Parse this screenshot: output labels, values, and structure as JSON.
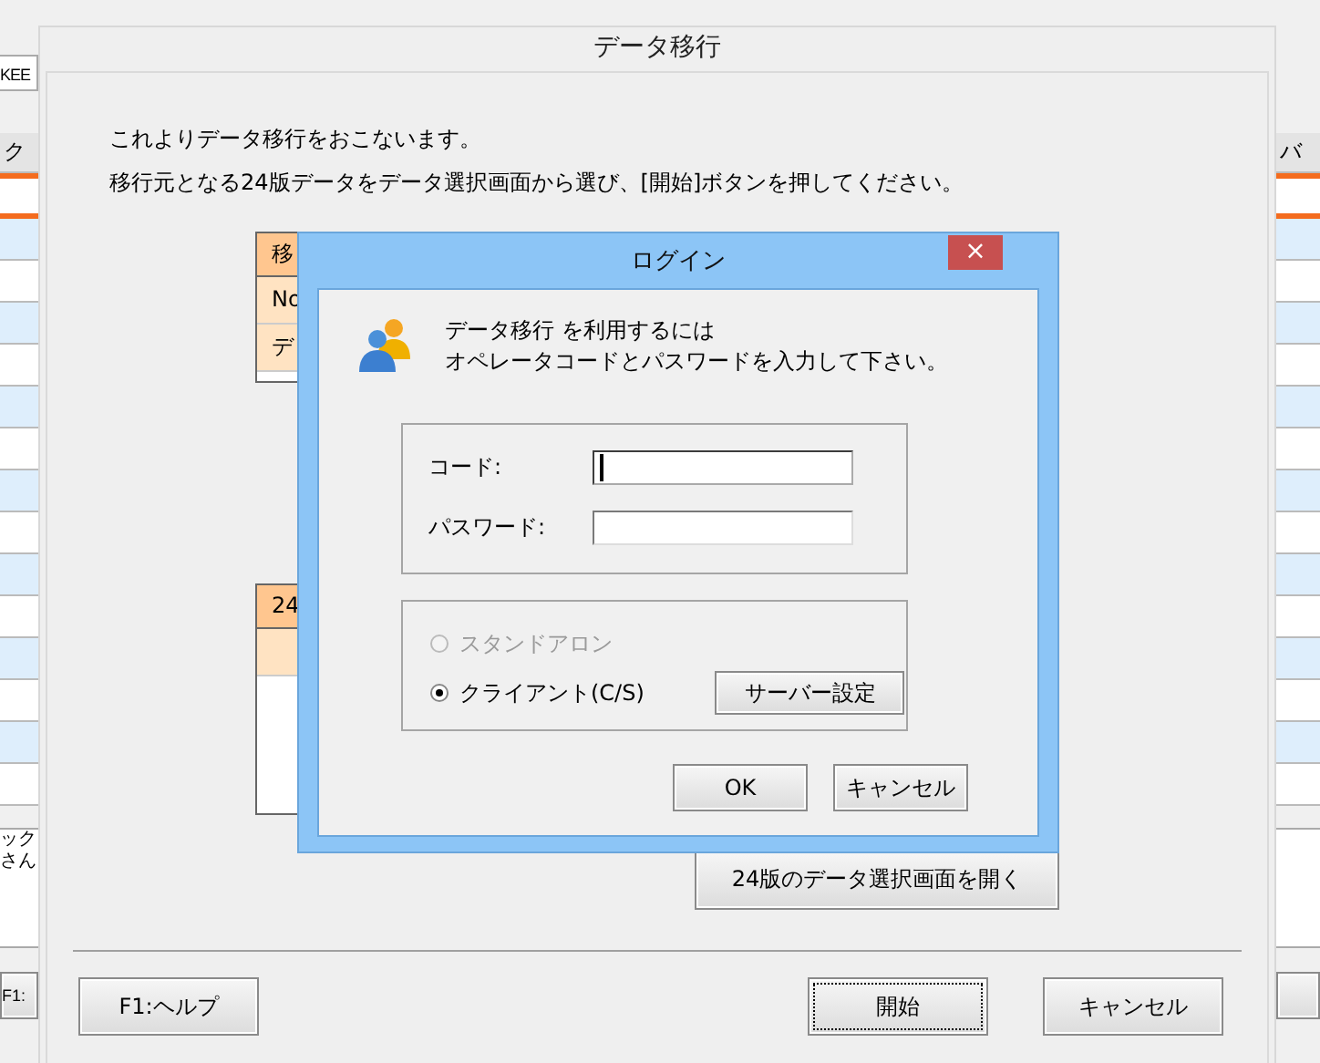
{
  "background_window": {
    "field_text": "KEE",
    "left_header": "ク",
    "right_header": "バ",
    "note_lines": [
      "ック",
      "さん"
    ],
    "button": "F1:"
  },
  "main_dialog": {
    "title": "データ移行",
    "intro": [
      "これよりデータ移行をおこないます。",
      "移行元となる24版データをデータ選択画面から選び、[開始]ボタンを押してください。"
    ],
    "source_table": {
      "header": "移",
      "rows": [
        "No",
        "デ"
      ]
    },
    "version_table": {
      "header": "24"
    },
    "open_button": "24版のデータ選択画面を開く",
    "buttons": [
      {
        "label": "F1:ヘルプ",
        "focused": false
      },
      {
        "label": "開始",
        "focused": true
      },
      {
        "label": "キャンセル",
        "focused": false
      }
    ]
  },
  "login_dialog": {
    "title": "ログイン",
    "close": "×",
    "message": [
      "データ移行 を利用するには",
      "オペレータコードとパスワードを入力して下さい。"
    ],
    "fields": [
      {
        "label": "コード:",
        "focused": true
      },
      {
        "label": "パスワード:",
        "focused": false
      }
    ],
    "modes": [
      {
        "label": "スタンドアロン",
        "selected": false,
        "disabled": true
      },
      {
        "label": "クライアント(C/S)",
        "selected": true,
        "disabled": false
      }
    ],
    "server_button": "サーバー設定",
    "buttons": [
      "OK",
      "キャンセル"
    ]
  }
}
